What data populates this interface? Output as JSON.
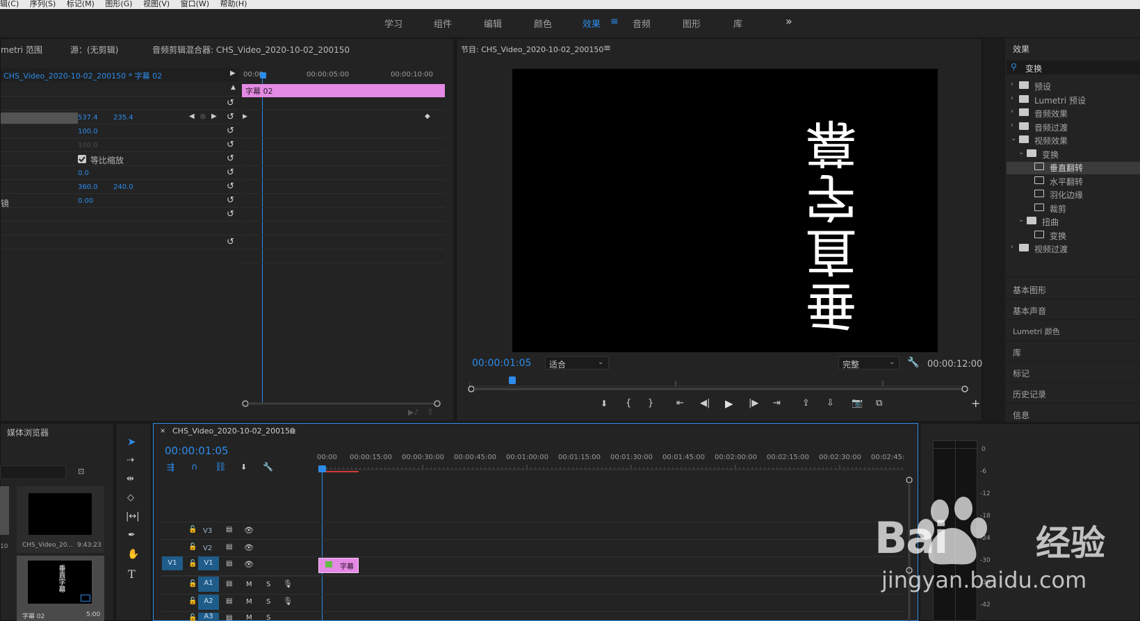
{
  "menubar": [
    "辑(C)",
    "序列(S)",
    "标记(M)",
    "图形(G)",
    "视图(V)",
    "窗口(W)",
    "帮助(H)"
  ],
  "workspaces": {
    "items": [
      "学习",
      "组件",
      "编辑",
      "颜色",
      "效果",
      "音频",
      "图形",
      "库"
    ],
    "active": "效果",
    "more": "»"
  },
  "effect_controls": {
    "tabs": [
      "metri 范围",
      "源：(无剪辑)",
      "音频剪辑混合器: CHS_Video_2020-10-02_200150"
    ],
    "clip_path": "CHS_Video_2020-10-02_200150 * 字幕 02",
    "ruler": [
      "00:00",
      "00:00:05:00",
      "00:00:10:00"
    ],
    "clip_bar_label": "字幕 02",
    "rows": [
      {
        "label": "",
        "v1": "537.4",
        "v2": "235.4"
      },
      {
        "label": "",
        "v1": "100.0",
        "v2": ""
      },
      {
        "label": "",
        "v1": "100.0",
        "v2": ""
      },
      {
        "label": "",
        "v1": "等比缩放",
        "v2": ""
      },
      {
        "label": "",
        "v1": "0.0",
        "v2": ""
      },
      {
        "label": "",
        "v1": "360.0",
        "v2": "240.0"
      },
      {
        "label": "镜",
        "v1": "0.00",
        "v2": ""
      }
    ]
  },
  "program_monitor": {
    "title": "节目: CHS_Video_2020-10-02_200150",
    "video_text": "垂直字幕",
    "timecode": "00:00:01:05",
    "fit": "适合",
    "quality": "完整",
    "duration": "00:00:12:00"
  },
  "effects_panel": {
    "title": "效果",
    "search": "变换",
    "tree": [
      {
        "label": "预设",
        "level": 0,
        "kind": "folder-star",
        "expanded": false
      },
      {
        "label": "Lumetri 预设",
        "level": 0,
        "kind": "folder-star",
        "expanded": false
      },
      {
        "label": "音频效果",
        "level": 0,
        "kind": "folder",
        "expanded": false
      },
      {
        "label": "音频过渡",
        "level": 0,
        "kind": "folder",
        "expanded": false
      },
      {
        "label": "视频效果",
        "level": 0,
        "kind": "folder",
        "expanded": true
      },
      {
        "label": "变换",
        "level": 1,
        "kind": "folder",
        "expanded": true
      },
      {
        "label": "垂直翻转",
        "level": 2,
        "kind": "effect",
        "selected": true
      },
      {
        "label": "水平翻转",
        "level": 2,
        "kind": "effect"
      },
      {
        "label": "羽化边缘",
        "level": 2,
        "kind": "effect"
      },
      {
        "label": "裁剪",
        "level": 2,
        "kind": "effect"
      },
      {
        "label": "扭曲",
        "level": 1,
        "kind": "folder",
        "expanded": true
      },
      {
        "label": "变换",
        "level": 2,
        "kind": "effect"
      },
      {
        "label": "视频过渡",
        "level": 0,
        "kind": "folder",
        "expanded": false
      }
    ],
    "side_panels": [
      "基本图形",
      "基本声音",
      "Lumetri 颜色",
      "库",
      "标记",
      "历史记录",
      "信息"
    ]
  },
  "project_panel": {
    "tab": "媒体浏览器",
    "items": [
      {
        "name": "CHS_Video_20...",
        "duration": "9:43:23"
      },
      {
        "name": "字幕 02",
        "duration": "5:00",
        "thumb_text": "垂直字幕"
      }
    ],
    "left_partial": "10"
  },
  "timeline": {
    "sequence": "CHS_Video_2020-10-02_200150",
    "timecode": "00:00:01:05",
    "ruler": [
      "00:00",
      "00:00:15:00",
      "00:00:30:00",
      "00:00:45:00",
      "00:01:00:00",
      "00:01:15:00",
      "00:01:30:00",
      "00:01:45:00",
      "00:02:00:00",
      "00:02:15:00",
      "00:02:30:00",
      "00:02:45:"
    ],
    "video_tracks": [
      "V3",
      "V2",
      "V1"
    ],
    "audio_tracks": [
      "A1",
      "A2",
      "A3"
    ],
    "source_patch": "V1",
    "clip_label": "字幕",
    "mute": "M",
    "solo": "S"
  },
  "audio_meter": {
    "scale": [
      "0",
      "-6",
      "-12",
      "-18",
      "-24",
      "-30",
      "-36",
      "-42"
    ]
  },
  "watermark": {
    "brand": "Bai",
    "brand_cn": "经验",
    "url": "jingyan.baidu.com"
  },
  "colors": {
    "accent": "#2d8ceb",
    "clip": "#e48ae4",
    "panel": "#232323",
    "bg": "#1b1b1b"
  }
}
